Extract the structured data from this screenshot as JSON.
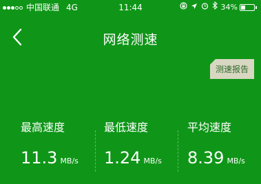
{
  "status_bar": {
    "carrier": "中国联通",
    "network": "4G",
    "time": "11:44",
    "battery_percent": "34%",
    "battery_level": 0.34
  },
  "nav": {
    "title": "网络测速"
  },
  "report_button": "测速报告",
  "stats": [
    {
      "label": "最高速度",
      "value": "11.3",
      "unit": "MB/s"
    },
    {
      "label": "最低速度",
      "value": "1.24",
      "unit": "MB/s"
    },
    {
      "label": "平均速度",
      "value": "8.39",
      "unit": "MB/s"
    }
  ],
  "colors": {
    "background": "#0f9618",
    "button_bg": "#d8d7c2",
    "button_text": "#2f6a2a"
  },
  "icons": [
    "signal-icon",
    "lock-rotation-icon",
    "location-arrow-icon",
    "alarm-icon",
    "bluetooth-icon",
    "battery-icon",
    "back-chevron-icon"
  ]
}
